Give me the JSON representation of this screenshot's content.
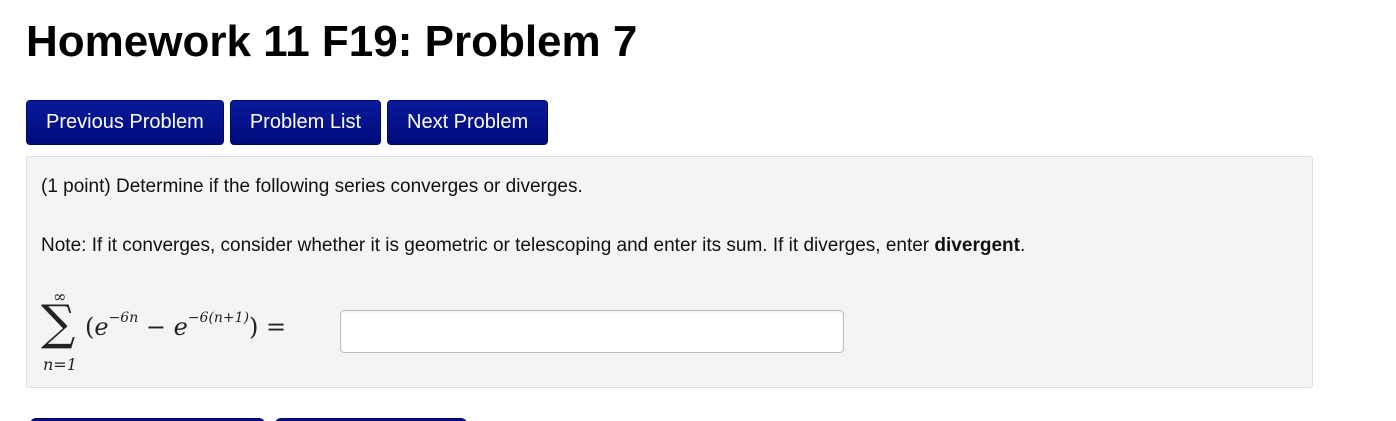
{
  "page": {
    "title": "Homework 11 F19: Problem 7"
  },
  "nav": {
    "previous_label": "Previous Problem",
    "list_label": "Problem List",
    "next_label": "Next Problem"
  },
  "problem": {
    "intro": "(1 point) Determine if the following series converges or diverges.",
    "note_prefix": "Note: If it converges, consider whether it is geometric or telescoping and enter its sum. If it diverges, enter ",
    "note_keyword": "divergent",
    "note_suffix": ".",
    "sum_upper": "∞",
    "sum_symbol": "∑",
    "sum_lower": "n=1",
    "expr_open": "(",
    "expr_e1": "e",
    "expr_exp1": "−6n",
    "expr_minus": " − ",
    "expr_e2": "e",
    "expr_exp2": "−6(n+1)",
    "expr_close": ")",
    "expr_equals": " = ",
    "answer_value": ""
  },
  "colors": {
    "button_bg": "#000e8b",
    "button_text": "#ffffff",
    "panel_bg": "#f4f4f4"
  }
}
